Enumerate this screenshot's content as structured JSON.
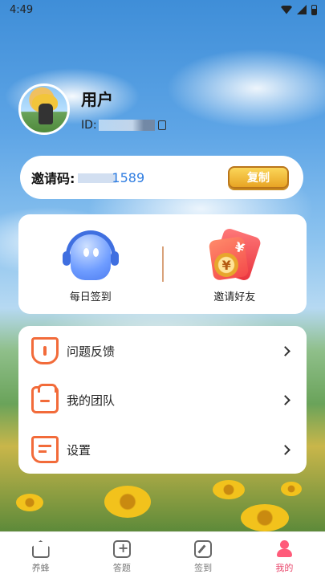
{
  "status_bar": {
    "time": "4:49"
  },
  "profile": {
    "name": "用户",
    "id_prefix": "ID:"
  },
  "invite": {
    "label": "邀请码:",
    "code_suffix": "1589",
    "copy_label": "复制"
  },
  "features": [
    {
      "label": "每日签到",
      "icon": "ghost-headphones-icon"
    },
    {
      "label": "邀请好友",
      "icon": "red-packet-icon"
    }
  ],
  "menu": [
    {
      "label": "问题反馈",
      "icon": "feedback-icon"
    },
    {
      "label": "我的团队",
      "icon": "team-icon"
    },
    {
      "label": "设置",
      "icon": "settings-icon"
    }
  ],
  "bottom_nav": [
    {
      "label": "养蜂",
      "icon": "home-icon",
      "active": false
    },
    {
      "label": "答题",
      "icon": "quiz-icon",
      "active": false
    },
    {
      "label": "签到",
      "icon": "sign-in-icon",
      "active": false
    },
    {
      "label": "我的",
      "icon": "profile-icon",
      "active": true
    }
  ],
  "colors": {
    "accent": "#e8456a",
    "menu_icon": "#f26b3a",
    "invite_code": "#2f7de1",
    "copy_button": "#f2bd3e"
  }
}
